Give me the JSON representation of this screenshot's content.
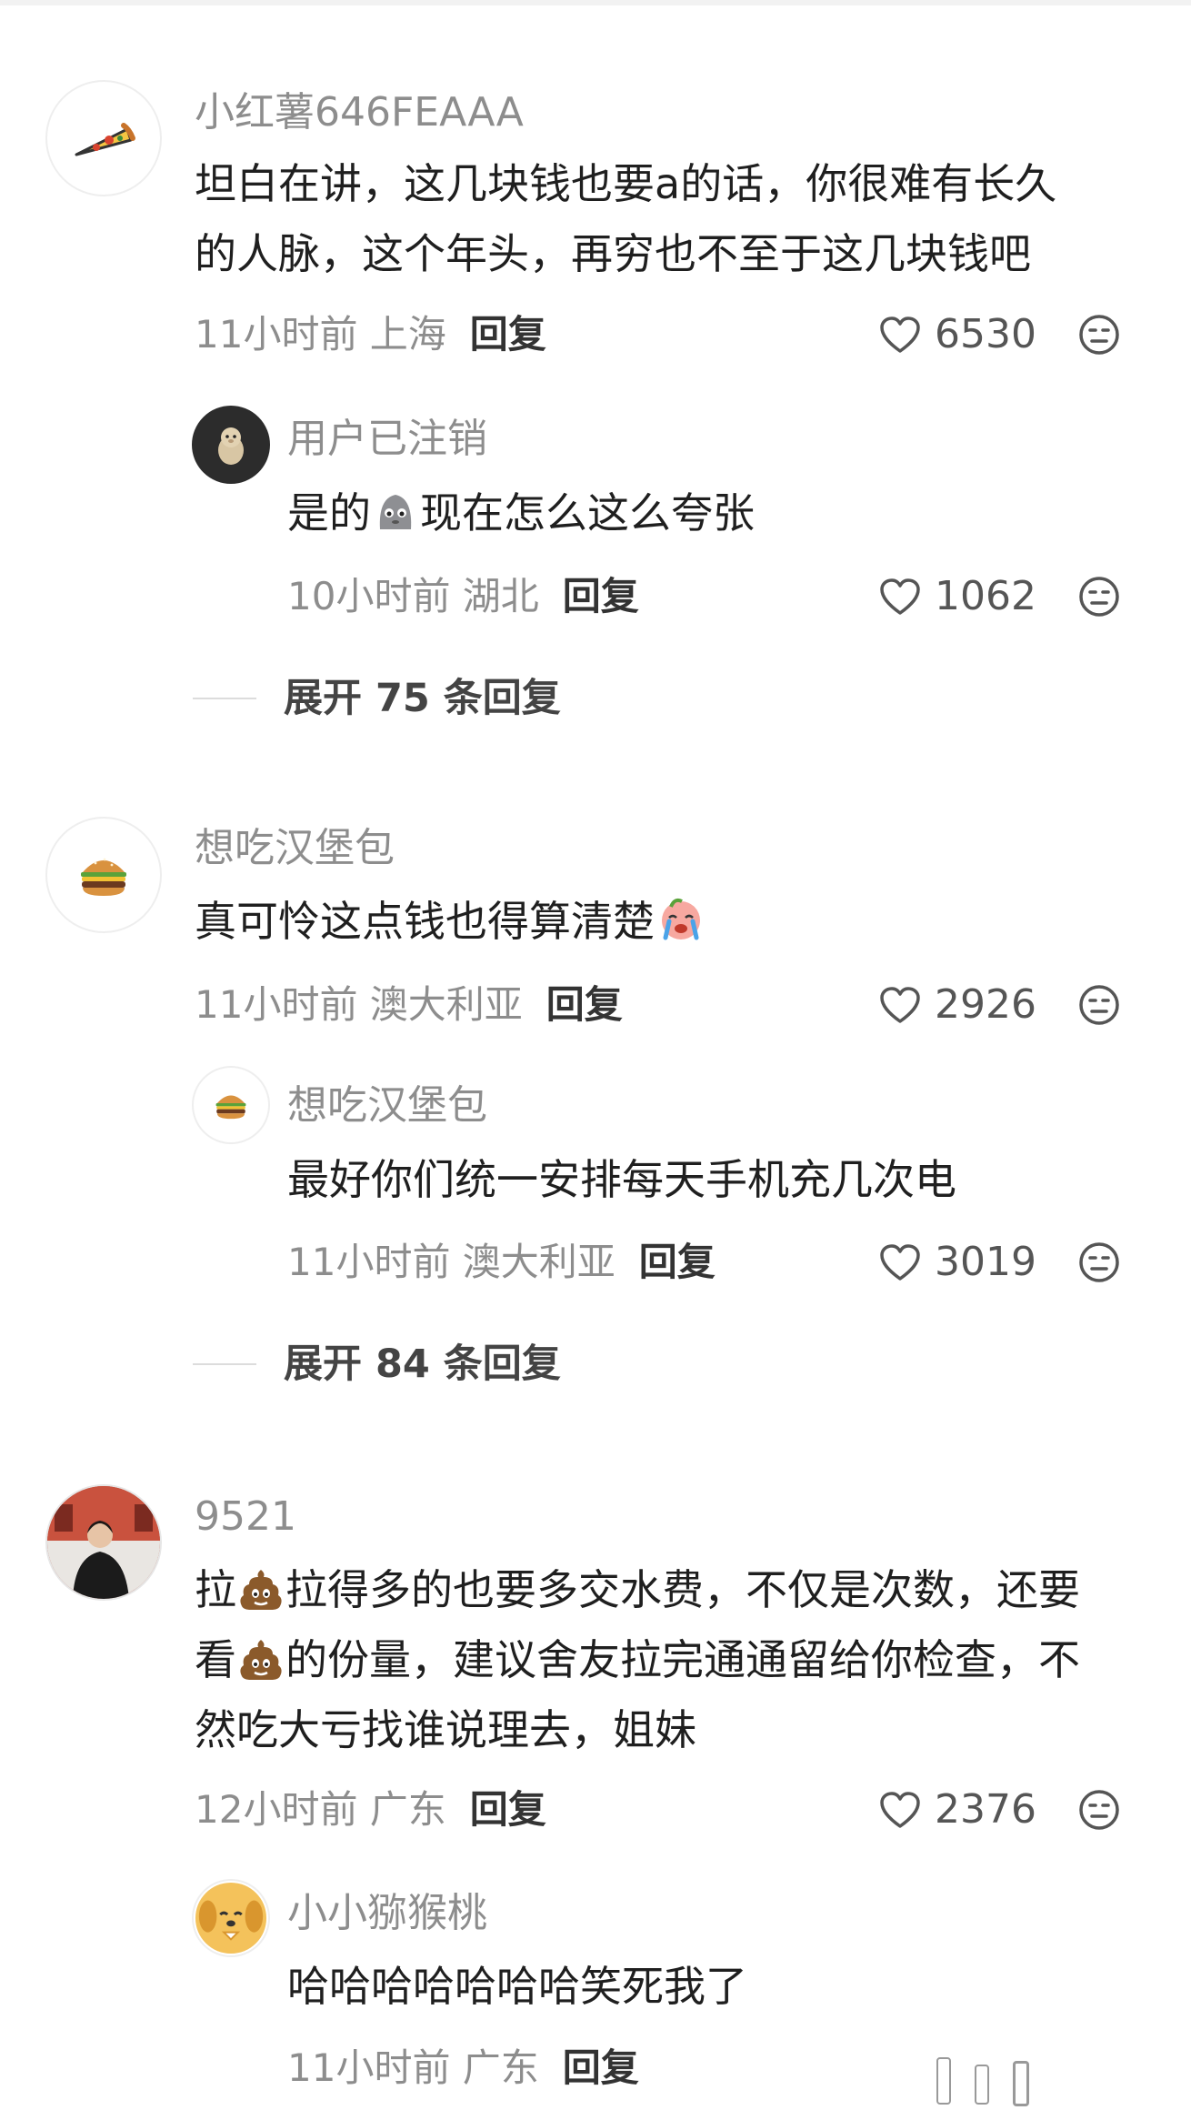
{
  "comments": [
    {
      "name": "小红薯646FEAAA",
      "avatar_icon": "pizza-icon",
      "text_line1": "坦白在讲，这几块钱也要a的话，你很难有长久",
      "text_line2": "的人脉，这个年头，再穷也不至于这几块钱吧",
      "meta": "11小时前 上海",
      "reply_label": "回复",
      "likes": "6530",
      "reply": {
        "name": "用户已注销",
        "avatar_icon": "hamster-icon",
        "text_before": "是的",
        "text_emoji": "grey-blob-emoji",
        "text_after": "现在怎么这么夸张",
        "meta": "10小时前 湖北",
        "reply_label": "回复",
        "likes": "1062"
      },
      "expand": "展开 75 条回复"
    },
    {
      "name": "想吃汉堡包",
      "avatar_icon": "burger-icon",
      "text_before": "真可怜这点钱也得算清楚",
      "text_emoji": "crying-face-emoji",
      "meta": "11小时前 澳大利亚",
      "reply_label": "回复",
      "likes": "2926",
      "reply": {
        "name": "想吃汉堡包",
        "avatar_icon": "burger-icon",
        "text": "最好你们统一安排每天手机充几次电",
        "meta": "11小时前 澳大利亚",
        "reply_label": "回复",
        "likes": "3019"
      },
      "expand": "展开 84 条回复"
    },
    {
      "name": "9521",
      "avatar_icon": "photo-avatar-icon",
      "line1_a": "拉",
      "line1_b": "拉得多的也要多交水费，不仅是次数，还要",
      "line2_a": "看",
      "line2_b": "的份量，建议舍友拉完通通留给你检查，不",
      "line3": "然吃大亏找谁说理去，姐妹",
      "emoji": "poop-emoji",
      "meta": "12小时前 广东",
      "reply_label": "回复",
      "likes": "2376",
      "reply": {
        "name": "小小猕猴桃",
        "avatar_icon": "dog-icon",
        "text": "哈哈哈哈哈哈哈笑死我了",
        "meta": "11小时前 广东",
        "reply_label": "回复"
      }
    }
  ],
  "colors": {
    "name_grey": "#8d8d8d",
    "text": "#1f1f1f",
    "reply_bold": "#333333"
  },
  "icons": {
    "like": "heart-outline-icon",
    "reaction": "neutral-face-icon",
    "watermark": "watermark-bars-icon"
  }
}
